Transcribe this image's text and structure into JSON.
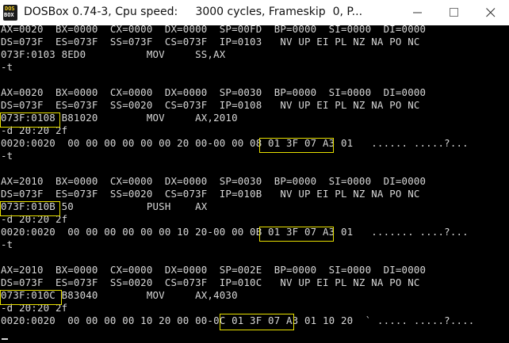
{
  "window": {
    "title": "DOSBox 0.74-3, Cpu speed:     3000 cycles, Frameskip  0, P...",
    "icon_name": "dosbox-app-icon",
    "icon_text_top": "DOS",
    "icon_text_bottom": "BOX",
    "controls": [
      "minimize-icon",
      "maximize-icon",
      "close-icon"
    ]
  },
  "console": {
    "text_color": "#d8d8d8",
    "highlight_color": "#e8e000",
    "lines": [
      "AX=0020  BX=0000  CX=0000  DX=0000  SP=00FD  BP=0000  SI=0000  DI=0000",
      "DS=073F  ES=073F  SS=073F  CS=073F  IP=0103   NV UP EI PL NZ NA PO NC",
      "073F:0103 8ED0          MOV     SS,AX",
      "-t",
      "",
      "AX=0020  BX=0000  CX=0000  DX=0000  SP=0030  BP=0000  SI=0000  DI=0000",
      "DS=073F  ES=073F  SS=0020  CS=073F  IP=0108   NV UP EI PL NZ NA PO NC",
      "073F:0108 B81020        MOV     AX,2010",
      "-d 20:20 2f",
      "0020:0020  00 00 00 00 00 00 20 00-00 00 08 01 3F 07 A3 01   ...... .....?...",
      "-t",
      "",
      "AX=2010  BX=0000  CX=0000  DX=0000  SP=0030  BP=0000  SI=0000  DI=0000",
      "DS=073F  ES=073F  SS=0020  CS=073F  IP=010B   NV UP EI PL NZ NA PO NC",
      "073F:010B 50            PUSH    AX",
      "-d 20:20 2f",
      "0020:0020  00 00 00 00 00 00 10 20-00 00 0B 01 3F 07 A3 01   ....... ....?...",
      "-t",
      "",
      "AX=2010  BX=0000  CX=0000  DX=0000  SP=002E  BP=0000  SI=0000  DI=0000",
      "DS=073F  ES=073F  SS=0020  CS=073F  IP=010C   NV UP EI PL NZ NA PO NC",
      "073F:010C B83040        MOV     AX,4030",
      "-d 20:20 2f",
      "0020:0020  00 00 00 00 10 20 00 00-0C 01 3F 07 A3 01 10 20  ` ..... .....?...."
    ]
  }
}
